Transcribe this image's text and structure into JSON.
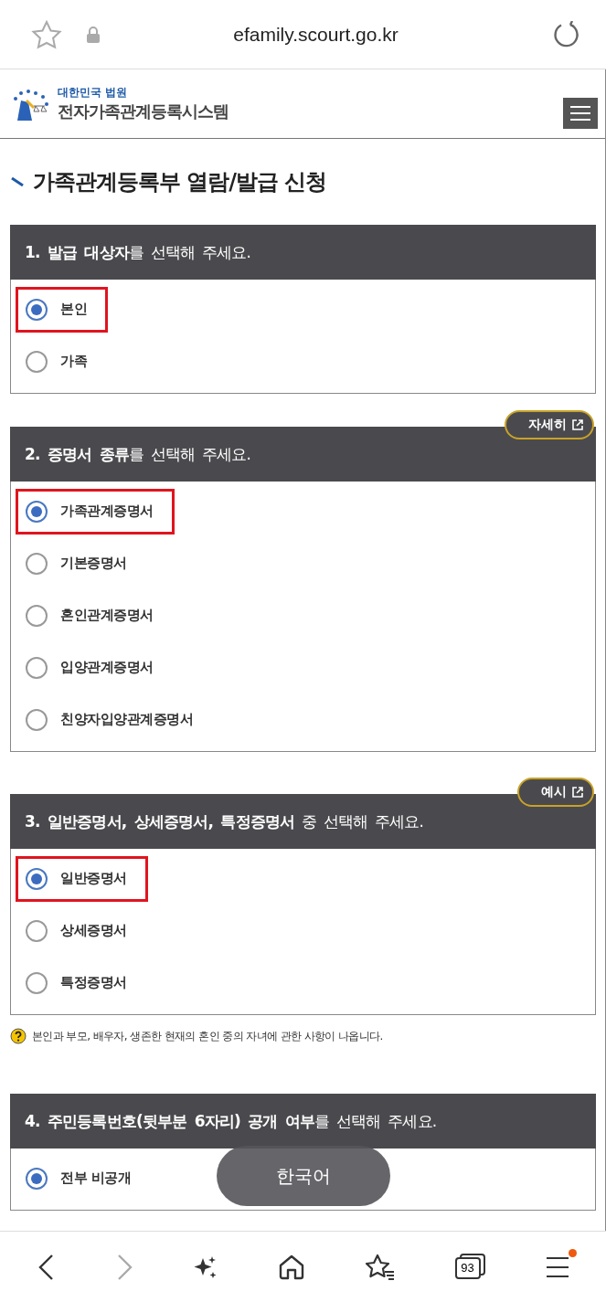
{
  "browser": {
    "url": "efamily.scourt.go.kr",
    "forward_disabled": true,
    "tab_count": "93",
    "menu_badge": true
  },
  "site": {
    "org": "대한민국 법원",
    "name": "전자가족관계등록시스템"
  },
  "page_title": "가족관계등록부 열람/발급 신청",
  "sections": [
    {
      "heading": "**1. 발급 대상자**를 선택해 주세요.",
      "options": [
        {
          "label": "본인",
          "selected": true,
          "highlighted": true
        },
        {
          "label": "가족",
          "selected": false,
          "highlighted": false
        }
      ]
    },
    {
      "link": "자세히",
      "heading": "**2. 증명서 종류**를 선택해 주세요.",
      "options": [
        {
          "label": "가족관계증명서",
          "selected": true,
          "highlighted": true
        },
        {
          "label": "기본증명서",
          "selected": false,
          "highlighted": false
        },
        {
          "label": "혼인관계증명서",
          "selected": false,
          "highlighted": false
        },
        {
          "label": "입양관계증명서",
          "selected": false,
          "highlighted": false
        },
        {
          "label": "친양자입양관계증명서",
          "selected": false,
          "highlighted": false
        }
      ]
    },
    {
      "link": "예시",
      "heading": "**3. 일반증명서, 상세증명서, 특정증명서** 중 선택해 주세요.",
      "options": [
        {
          "label": "일반증명서",
          "selected": true,
          "highlighted": true
        },
        {
          "label": "상세증명서",
          "selected": false,
          "highlighted": false
        },
        {
          "label": "특정증명서",
          "selected": false,
          "highlighted": false
        }
      ],
      "note": "본인과 부모, 배우자, 생존한 현재의 혼인 중의 자녀에 관한 사항이 나옵니다."
    },
    {
      "heading": "**4. 주민등록번호(뒷부분 6자리) 공개 여부**를 선택해 주세요.",
      "options": [
        {
          "label": "전부 비공개",
          "selected": true,
          "highlighted": false
        }
      ]
    }
  ],
  "toast": "한국어"
}
